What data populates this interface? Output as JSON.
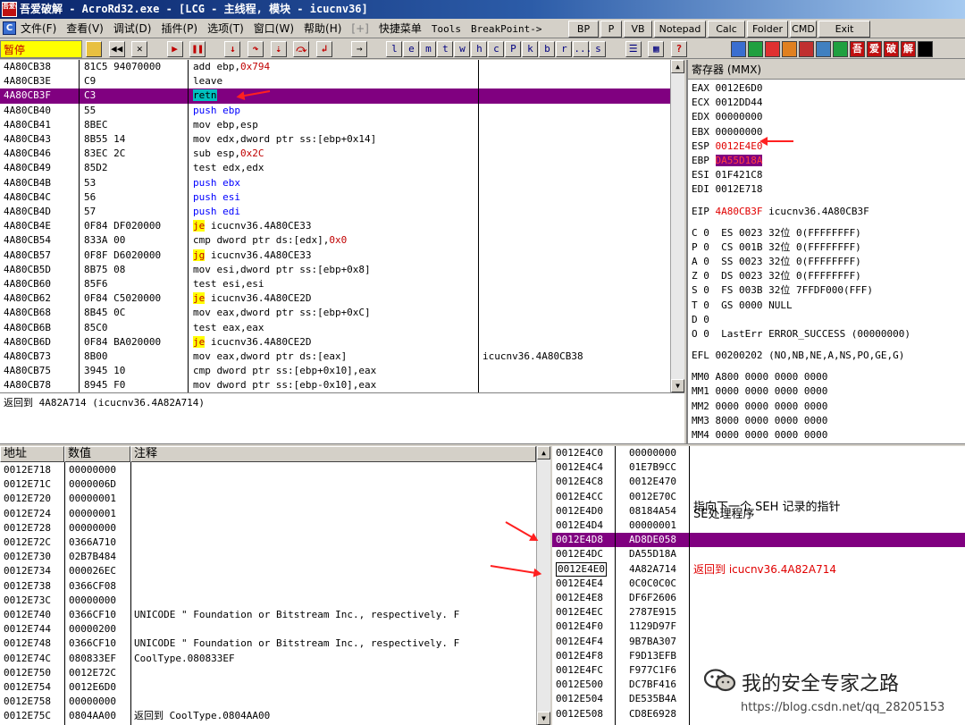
{
  "title": "吾爱破解 - AcroRd32.exe - [LCG - 主线程, 模块 - icucnv36]",
  "title_icon_text": "吾爱破解",
  "menu": [
    "文件(F)",
    "查看(V)",
    "调试(D)",
    "插件(P)",
    "选项(T)",
    "窗口(W)",
    "帮助(H)",
    "[+]",
    "快捷菜单",
    "Tools",
    "BreakPoint->"
  ],
  "top_buttons": [
    "BP",
    "P",
    "VB",
    "Notepad",
    "Calc",
    "Folder",
    "CMD",
    "Exit"
  ],
  "status_text": "暂停",
  "letter_buttons": [
    "l",
    "e",
    "m",
    "t",
    "w",
    "h",
    "c",
    "P",
    "k",
    "b",
    "r",
    "...",
    "s"
  ],
  "right_tool_icons": [
    "refresh-icon",
    "pause-icon",
    "font-icon",
    "circle-icon",
    "target-icon",
    "calc-icon",
    "grid-icon",
    "吾",
    "爱",
    "破",
    "解",
    "black-icon"
  ],
  "disasm": [
    {
      "addr": "4A80CB38",
      "hex": "81C5 94070000",
      "asm": "add ebp,",
      "arg": "0x794",
      "cls": "",
      "comment": ""
    },
    {
      "addr": "4A80CB3E",
      "hex": "C9",
      "asm": "leave",
      "arg": "",
      "cls": "",
      "comment": ""
    },
    {
      "addr": "4A80CB3F",
      "hex": "C3",
      "asm": "retn",
      "arg": "",
      "cls": "hl",
      "comment": ""
    },
    {
      "addr": "4A80CB40",
      "hex": "55",
      "asm": "push ebp",
      "arg": "",
      "cls": "blue",
      "comment": ""
    },
    {
      "addr": "4A80CB41",
      "hex": "8BEC",
      "asm": "mov ebp,esp",
      "arg": "",
      "cls": "",
      "comment": ""
    },
    {
      "addr": "4A80CB43",
      "hex": "8B55 14",
      "asm": "mov edx,dword ptr ss:[ebp+0x14]",
      "arg": "",
      "cls": "",
      "comment": ""
    },
    {
      "addr": "4A80CB46",
      "hex": "83EC 2C",
      "asm": "sub esp,",
      "arg": "0x2C",
      "cls": "",
      "comment": ""
    },
    {
      "addr": "4A80CB49",
      "hex": "85D2",
      "asm": "test edx,edx",
      "arg": "",
      "cls": "",
      "comment": ""
    },
    {
      "addr": "4A80CB4B",
      "hex": "53",
      "asm": "push ebx",
      "arg": "",
      "cls": "blue",
      "comment": ""
    },
    {
      "addr": "4A80CB4C",
      "hex": "56",
      "asm": "push esi",
      "arg": "",
      "cls": "blue",
      "comment": ""
    },
    {
      "addr": "4A80CB4D",
      "hex": "57",
      "asm": "push edi",
      "arg": "",
      "cls": "blue",
      "comment": ""
    },
    {
      "addr": "4A80CB4E",
      "hex": "0F84 DF020000",
      "asm": "je",
      "arg": " icucnv36.4A80CE33",
      "cls": "jmp",
      "comment": ""
    },
    {
      "addr": "4A80CB54",
      "hex": "833A 00",
      "asm": "cmp dword ptr ds:[edx],",
      "arg": "0x0",
      "cls": "",
      "comment": ""
    },
    {
      "addr": "4A80CB57",
      "hex": "0F8F D6020000",
      "asm": "jg",
      "arg": " icucnv36.4A80CE33",
      "cls": "jmp",
      "comment": ""
    },
    {
      "addr": "4A80CB5D",
      "hex": "8B75 08",
      "asm": "mov esi,dword ptr ss:[ebp+0x8]",
      "arg": "",
      "cls": "",
      "comment": ""
    },
    {
      "addr": "4A80CB60",
      "hex": "85F6",
      "asm": "test esi,esi",
      "arg": "",
      "cls": "",
      "comment": ""
    },
    {
      "addr": "4A80CB62",
      "hex": "0F84 C5020000",
      "asm": "je",
      "arg": " icucnv36.4A80CE2D",
      "cls": "jmp",
      "comment": ""
    },
    {
      "addr": "4A80CB68",
      "hex": "8B45 0C",
      "asm": "mov eax,dword ptr ss:[ebp+0xC]",
      "arg": "",
      "cls": "",
      "comment": ""
    },
    {
      "addr": "4A80CB6B",
      "hex": "85C0",
      "asm": "test eax,eax",
      "arg": "",
      "cls": "",
      "comment": ""
    },
    {
      "addr": "4A80CB6D",
      "hex": "0F84 BA020000",
      "asm": "je",
      "arg": " icucnv36.4A80CE2D",
      "cls": "jmp",
      "comment": ""
    },
    {
      "addr": "4A80CB73",
      "hex": "8B00",
      "asm": "mov eax,dword ptr ds:[eax]",
      "arg": "",
      "cls": "",
      "comment": "icucnv36.4A80CB38"
    },
    {
      "addr": "4A80CB75",
      "hex": "3945 10",
      "asm": "cmp dword ptr ss:[ebp+0x10],eax",
      "arg": "",
      "cls": "",
      "comment": ""
    },
    {
      "addr": "4A80CB78",
      "hex": "8945 F0",
      "asm": "mov dword ptr ss:[ebp-0x10],eax",
      "arg": "",
      "cls": "",
      "comment": ""
    }
  ],
  "info_line": "返回到 4A82A714 (icucnv36.4A82A714)",
  "registers_title": "寄存器 (MMX)",
  "registers": [
    {
      "name": "EAX",
      "value": "0012E6D0",
      "style": ""
    },
    {
      "name": "ECX",
      "value": "0012DD44",
      "style": ""
    },
    {
      "name": "EDX",
      "value": "00000000",
      "style": ""
    },
    {
      "name": "EBX",
      "value": "00000000",
      "style": ""
    },
    {
      "name": "ESP",
      "value": "0012E4E0",
      "style": "red"
    },
    {
      "name": "EBP",
      "value": "DA55D18A",
      "style": "hl"
    },
    {
      "name": "ESI",
      "value": "01F421C8",
      "style": ""
    },
    {
      "name": "EDI",
      "value": "0012E718",
      "style": ""
    }
  ],
  "eip": {
    "name": "EIP",
    "value": "4A80CB3F",
    "desc": "icucnv36.4A80CB3F"
  },
  "flags": [
    "C 0  ES 0023 32位 0(FFFFFFFF)",
    "P 0  CS 001B 32位 0(FFFFFFFF)",
    "A 0  SS 0023 32位 0(FFFFFFFF)",
    "Z 0  DS 0023 32位 0(FFFFFFFF)",
    "S 0  FS 003B 32位 7FFDF000(FFF)",
    "T 0  GS 0000 NULL",
    "D 0",
    "O 0  LastErr ERROR_SUCCESS (00000000)"
  ],
  "efl": "EFL 00200202 (NO,NB,NE,A,NS,PO,GE,G)",
  "mmx": [
    "MM0 A800 0000 0000 0000",
    "MM1 0000 0000 0000 0000",
    "MM2 0000 0000 0000 0000",
    "MM3 8000 0000 0000 0000",
    "MM4 0000 0000 0000 0000"
  ],
  "dump_headers": [
    "地址",
    "数值",
    "注释"
  ],
  "dump": [
    {
      "addr": "0012E718",
      "val": "00000000",
      "note": ""
    },
    {
      "addr": "0012E71C",
      "val": "0000006D",
      "note": ""
    },
    {
      "addr": "0012E720",
      "val": "00000001",
      "note": ""
    },
    {
      "addr": "0012E724",
      "val": "00000001",
      "note": ""
    },
    {
      "addr": "0012E728",
      "val": "00000000",
      "note": ""
    },
    {
      "addr": "0012E72C",
      "val": "0366A710",
      "note": ""
    },
    {
      "addr": "0012E730",
      "val": "02B7B484",
      "note": ""
    },
    {
      "addr": "0012E734",
      "val": "000026EC",
      "note": ""
    },
    {
      "addr": "0012E738",
      "val": "0366CF08",
      "note": ""
    },
    {
      "addr": "0012E73C",
      "val": "00000000",
      "note": ""
    },
    {
      "addr": "0012E740",
      "val": "0366CF10",
      "note": "UNICODE \" Foundation or Bitstream Inc., respectively. F"
    },
    {
      "addr": "0012E744",
      "val": "00000200",
      "note": ""
    },
    {
      "addr": "0012E748",
      "val": "0366CF10",
      "note": "UNICODE \" Foundation or Bitstream Inc., respectively. F"
    },
    {
      "addr": "0012E74C",
      "val": "080833EF",
      "note": "CoolType.080833EF"
    },
    {
      "addr": "0012E750",
      "val": "0012E72C",
      "note": ""
    },
    {
      "addr": "0012E754",
      "val": "0012E6D0",
      "note": ""
    },
    {
      "addr": "0012E758",
      "val": "00000000",
      "note": ""
    },
    {
      "addr": "0012E75C",
      "val": "0804AA00",
      "note": "返回到 CoolType.0804AA00"
    }
  ],
  "stack": [
    {
      "addr": "0012E4C0",
      "val": "00000000",
      "note": "",
      "style": ""
    },
    {
      "addr": "0012E4C4",
      "val": "01E7B9CC",
      "note": "",
      "style": ""
    },
    {
      "addr": "0012E4C8",
      "val": "0012E470",
      "note": "",
      "style": ""
    },
    {
      "addr": "0012E4CC",
      "val": "0012E70C",
      "note": "指向下一个 SEH 记录的指针",
      "style": ""
    },
    {
      "addr": "0012E4D0",
      "val": "08184A54",
      "note": "SE处理程序",
      "style": ""
    },
    {
      "addr": "0012E4D4",
      "val": "00000001",
      "note": "",
      "style": ""
    },
    {
      "addr": "0012E4D8",
      "val": "AD8DE058",
      "note": "",
      "style": "hl"
    },
    {
      "addr": "0012E4DC",
      "val": "DA55D18A",
      "note": "",
      "style": ""
    },
    {
      "addr": "0012E4E0",
      "val": "4A82A714",
      "note": "返回到 icucnv36.4A82A714",
      "style": "cur"
    },
    {
      "addr": "0012E4E4",
      "val": "0C0C0C0C",
      "note": "",
      "style": ""
    },
    {
      "addr": "0012E4E8",
      "val": "DF6F2606",
      "note": "",
      "style": ""
    },
    {
      "addr": "0012E4EC",
      "val": "2787E915",
      "note": "",
      "style": ""
    },
    {
      "addr": "0012E4F0",
      "val": "1129D97F",
      "note": "",
      "style": ""
    },
    {
      "addr": "0012E4F4",
      "val": "9B7BA307",
      "note": "",
      "style": ""
    },
    {
      "addr": "0012E4F8",
      "val": "F9D13EFB",
      "note": "",
      "style": ""
    },
    {
      "addr": "0012E4FC",
      "val": "F977C1F6",
      "note": "",
      "style": ""
    },
    {
      "addr": "0012E500",
      "val": "DC7BF416",
      "note": "",
      "style": ""
    },
    {
      "addr": "0012E504",
      "val": "DE535B4A",
      "note": "",
      "style": ""
    },
    {
      "addr": "0012E508",
      "val": "CD8E6928",
      "note": "",
      "style": ""
    }
  ],
  "watermark": "我的安全专家之路",
  "watermark_url": "https://blog.csdn.net/qq_28205153",
  "colors": {
    "highlight": "#800080",
    "status_bg": "#ffff00",
    "red": "#e00000",
    "blue": "#0000ff"
  }
}
